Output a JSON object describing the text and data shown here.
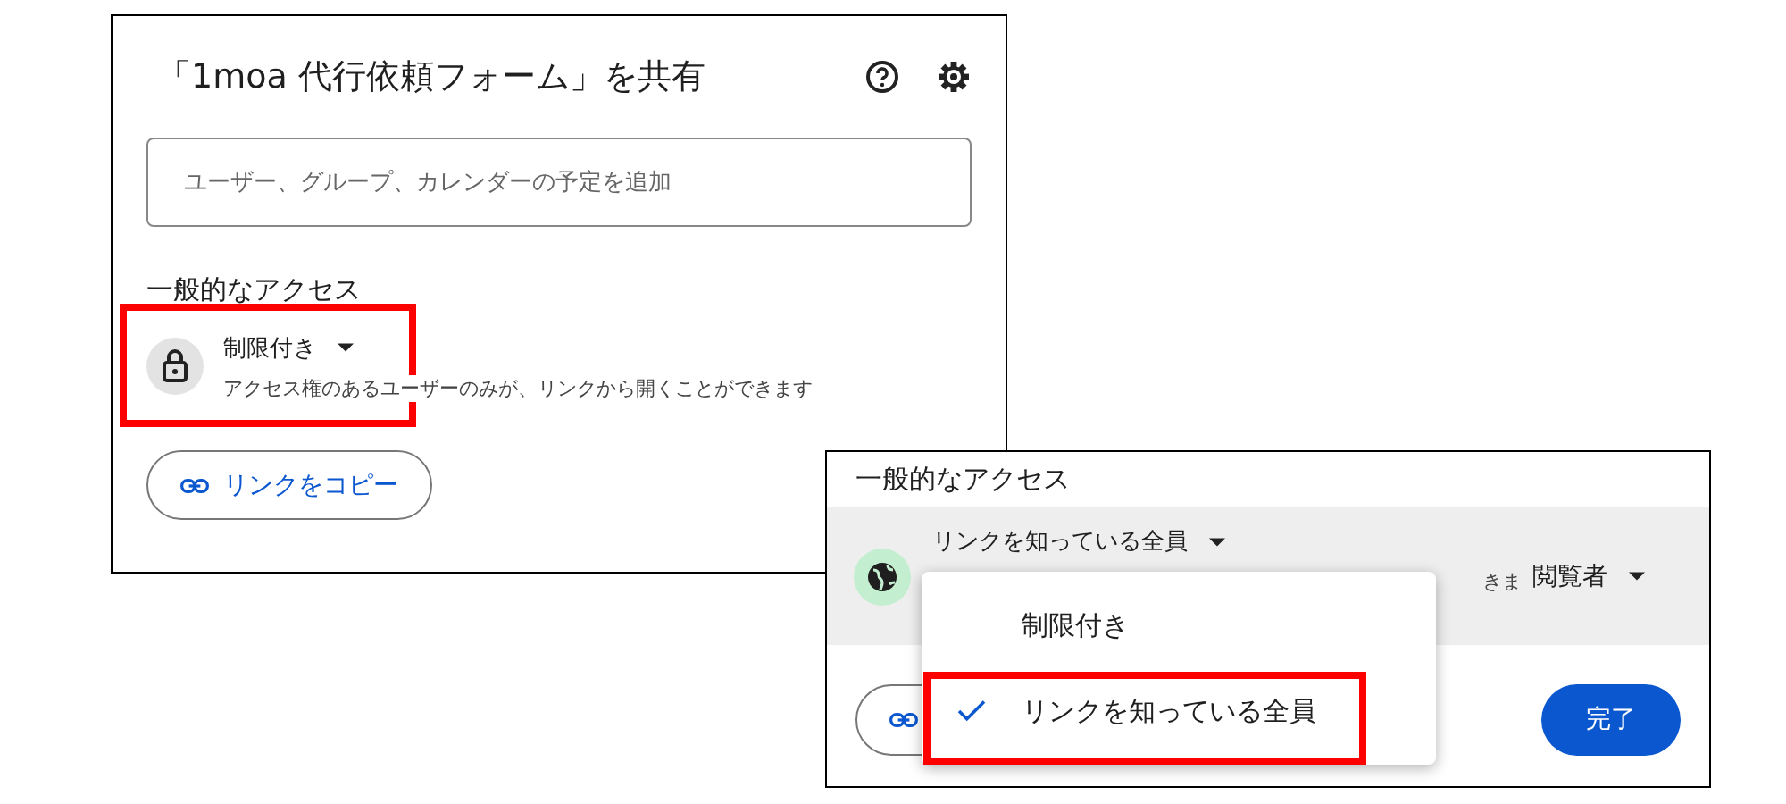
{
  "share_dialog": {
    "title": "「1moa 代行依頼フォーム」を共有",
    "add_field": {
      "placeholder": "ユーザー、グループ、カレンダーの予定を追加"
    },
    "general_access_heading": "一般的なアクセス",
    "access": {
      "kind": "restricted",
      "label": "制限付き",
      "description": "アクセス権のあるユーザーのみが、リンクから開くことができます",
      "highlighted": true
    },
    "copy_link_button": "リンクをコピー"
  },
  "access_menu_dialog": {
    "general_access_heading": "一般的なアクセス",
    "access": {
      "kind": "public",
      "label": "リンクを知っている全員",
      "description": "きま"
    },
    "role": "閲覧者",
    "menu": {
      "items": [
        {
          "label": "制限付き",
          "selected": false,
          "highlighted": false
        },
        {
          "label": "リンクを知っている全員",
          "selected": true,
          "highlighted": true
        }
      ]
    },
    "done_button": "完了"
  }
}
